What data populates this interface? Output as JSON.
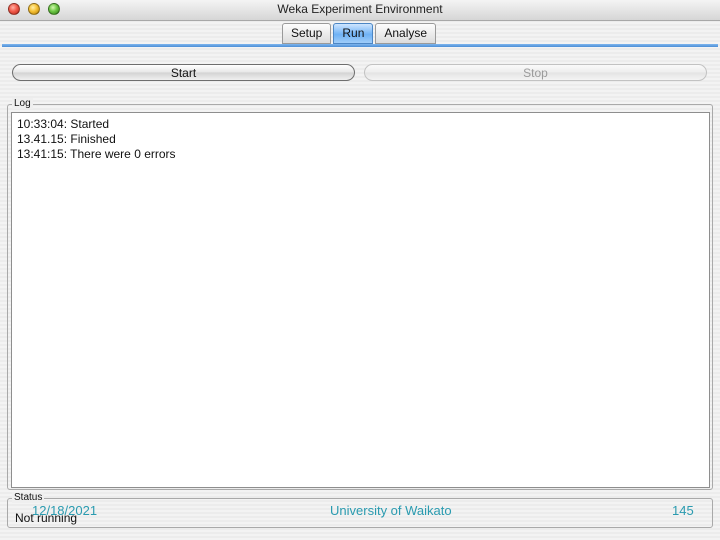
{
  "window": {
    "title": "Weka Experiment Environment"
  },
  "tabs": [
    {
      "label": "Setup",
      "active": false
    },
    {
      "label": "Run",
      "active": true
    },
    {
      "label": "Analyse",
      "active": false
    }
  ],
  "controls": {
    "start_label": "Start",
    "stop_label": "Stop"
  },
  "log": {
    "label": "Log",
    "lines": [
      "10:33:04: Started",
      "13.41.15: Finished",
      "13:41:15: There were 0 errors"
    ]
  },
  "status": {
    "label": "Status",
    "text": "Not running"
  },
  "footer": {
    "date": "12/18/2021",
    "organization": "University of Waikato",
    "page_number": "145"
  },
  "colors": {
    "active_tab": "#6fb2f5",
    "tab_underline": "#4c8ed6",
    "footer_text": "#2a9bb0"
  }
}
